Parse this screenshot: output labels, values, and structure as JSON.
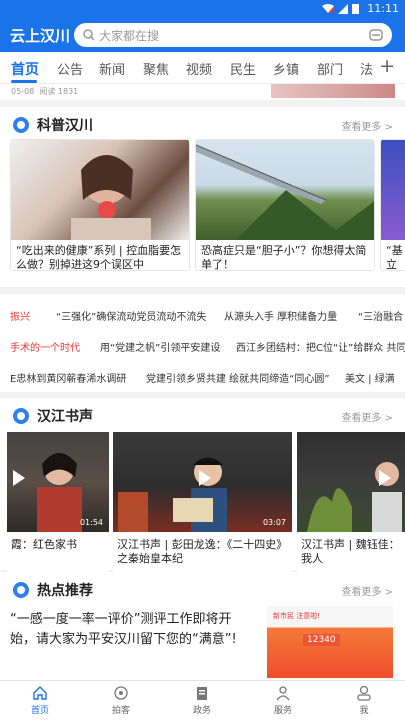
{
  "status_bar": {
    "time": "11:11"
  },
  "app": {
    "title": "云上汉川"
  },
  "search": {
    "placeholder": "大家都在搜"
  },
  "tabs": [
    {
      "label": "首页",
      "active": true
    },
    {
      "label": "公告"
    },
    {
      "label": "新闻"
    },
    {
      "label": "聚焦"
    },
    {
      "label": "视频"
    },
    {
      "label": "民生"
    },
    {
      "label": "乡镇"
    },
    {
      "label": "部门"
    },
    {
      "label": "法"
    }
  ],
  "prev_item": {
    "date": "05-08",
    "reads": "阅读 1831"
  },
  "science": {
    "title": "科普汉川",
    "more": "查看更多 >",
    "cards": [
      {
        "caption": "“吃出来的健康”系列 | 控血脂要怎么做？别掉进这9个误区中"
      },
      {
        "caption": "恐高症只是“胆子小”？你想得太简单了！"
      },
      {
        "caption": "“基立首飞"
      }
    ]
  },
  "ticker": {
    "rows": [
      [
        "振兴",
        "“三强化”确保流动党员流动不流失",
        "从源头入手 厚积储备力量",
        "“三治融合"
      ],
      [
        "手术的一个时代",
        "用“党建之帆”引领平安建设",
        "西江乡团结村：把C位“让”给群众 共同",
        ""
      ],
      [
        "E忠林到黄冈蕲春浠水调研",
        "党建引领乡贤共建 绘就共同缔造“同心圆”",
        "美文 | 绿满"
      ]
    ]
  },
  "voice": {
    "title": "汉江书声",
    "more": "查看更多 >",
    "videos": [
      {
        "duration": "01:54",
        "caption": "霞：红色家书"
      },
      {
        "duration": "03:07",
        "caption": "汉江书声 | 彭田龙逸：《二十四史》之秦始皇本纪"
      },
      {
        "duration": "",
        "caption": "汉江书声 | 魏钰佳：我人"
      }
    ]
  },
  "hot": {
    "title": "热点推荐",
    "more": "查看更多 >",
    "text": "“一感一度一率一评价”测评工作即将开始，请大家为平安汉川留下您的“满意”!",
    "image_headline": "新市民 注意啦!",
    "image_number": "12340"
  },
  "bottom_nav": [
    {
      "label": "首页",
      "icon": "home-icon",
      "active": true
    },
    {
      "label": "拍客",
      "icon": "camera-icon"
    },
    {
      "label": "政务",
      "icon": "clipboard-icon"
    },
    {
      "label": "服务",
      "icon": "user-service-icon"
    },
    {
      "label": "我",
      "icon": "profile-icon"
    }
  ],
  "colors": {
    "brand": "#1a73e8",
    "accent_red": "#e53935"
  }
}
